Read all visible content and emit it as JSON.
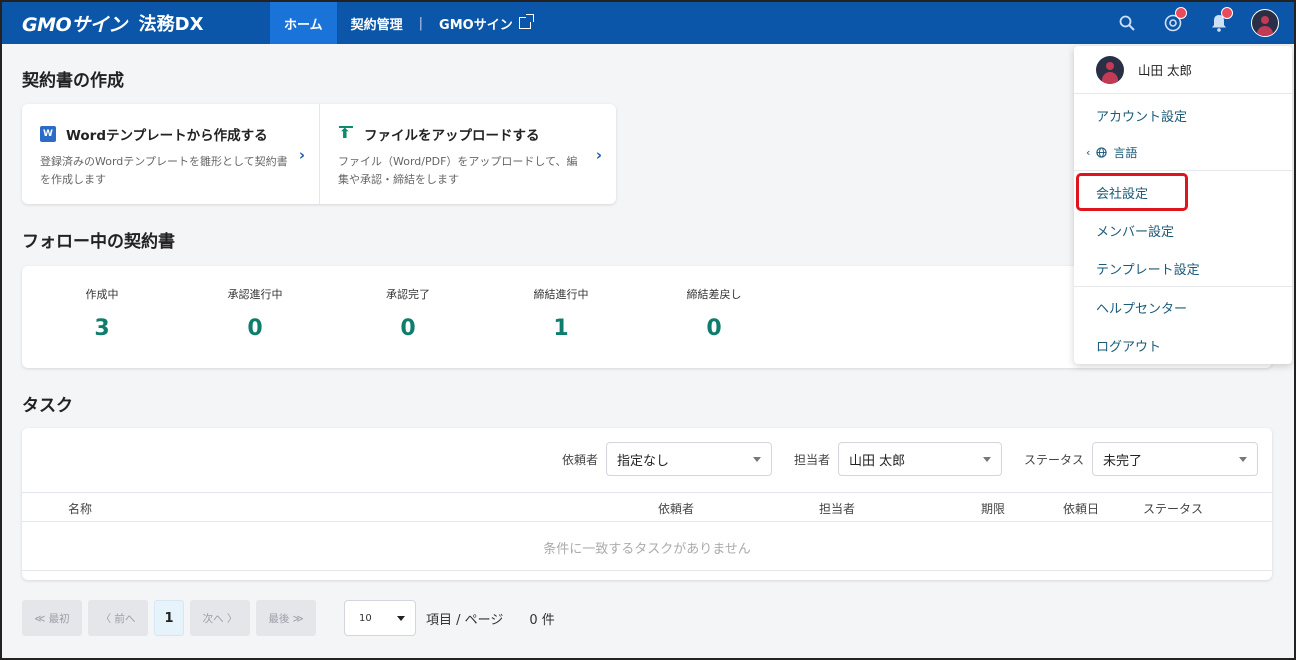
{
  "header": {
    "logo_gmo": "GMOサイン",
    "logo_product": "法務DX",
    "nav": [
      {
        "label": "ホーム",
        "active": true
      },
      {
        "label": "契約管理"
      },
      {
        "label": "GMOサイン"
      }
    ],
    "icons": [
      "search-icon",
      "mention-icon",
      "bell-icon",
      "avatar"
    ]
  },
  "create_section": {
    "title": "契約書の作成",
    "items": [
      {
        "icon": "word-icon",
        "icon_text": "W",
        "title": "Wordテンプレートから作成する",
        "desc": "登録済みのWordテンプレートを雛形として契約書を作成します"
      },
      {
        "icon": "upload-icon",
        "title": "ファイルをアップロードする",
        "desc": "ファイル（Word/PDF）をアップロードして、編集や承認・締結をします"
      }
    ]
  },
  "follow_section": {
    "title": "フォロー中の契約書",
    "stats": [
      {
        "label": "作成中",
        "value": "3"
      },
      {
        "label": "承認進行中",
        "value": "0"
      },
      {
        "label": "承認完了",
        "value": "0"
      },
      {
        "label": "締結進行中",
        "value": "1"
      },
      {
        "label": "締結差戻し",
        "value": "0"
      }
    ]
  },
  "task_section": {
    "title": "タスク",
    "filters": [
      {
        "label": "依頼者",
        "value": "指定なし"
      },
      {
        "label": "担当者",
        "value": "山田 太郎"
      },
      {
        "label": "ステータス",
        "value": "未完了"
      }
    ],
    "columns": [
      "名称",
      "依頼者",
      "担当者",
      "期限",
      "依頼日",
      "ステータス"
    ],
    "empty_message": "条件に一致するタスクがありません"
  },
  "pager": {
    "first": "≪ 最初",
    "prev": "〈 前へ",
    "current": "1",
    "next": "次へ 〉",
    "last": "最後 ≫",
    "page_size": "10",
    "per_page_label": "項目 / ページ",
    "total": "0 件"
  },
  "user_menu": {
    "username": "山田 太郎",
    "items": {
      "account": "アカウント設定",
      "language": "言語",
      "company": "会社設定",
      "member": "メンバー設定",
      "template": "テンプレート設定",
      "help": "ヘルプセンター",
      "logout": "ログアウト"
    }
  },
  "colors": {
    "header": "#0b56a8",
    "nav_active": "#1a73d9",
    "accent_green": "#0e7d6c",
    "highlight": "#e0141c"
  }
}
